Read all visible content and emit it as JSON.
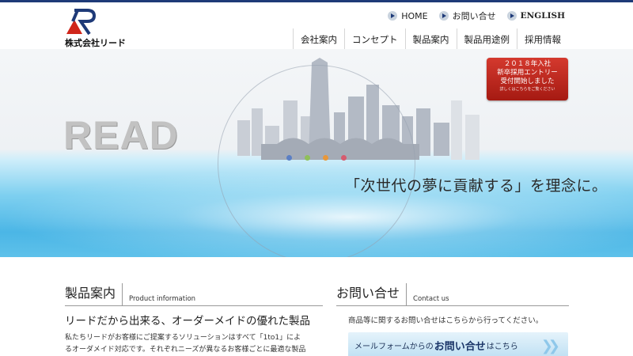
{
  "header": {
    "logo_text": "株式会社リード",
    "util_nav": [
      {
        "label": "HOME"
      },
      {
        "label": "お問い合せ"
      },
      {
        "label": "ENGLISH"
      }
    ],
    "main_nav": [
      {
        "label": "会社案内"
      },
      {
        "label": "コンセプト"
      },
      {
        "label": "製品案内"
      },
      {
        "label": "製品用途例"
      },
      {
        "label": "採用情報"
      }
    ]
  },
  "hero": {
    "brand_text": "READ",
    "tagline": "「次世代の夢に貢献する」を理念に。",
    "recruit": {
      "line1": "２０１８年入社",
      "line2": "新卒採用エントリー",
      "line3": "受付開始しました",
      "small": "詳しくはこちらをご覧ください"
    },
    "dot_colors": [
      "#5b7fc4",
      "#8fbf5a",
      "#e8973a",
      "#d65b6e"
    ]
  },
  "products": {
    "title": "製品案内",
    "subtitle": "Product information",
    "lead": "リードだから出来る、オーダーメイドの優れた製品",
    "body_line1": "私たちリードがお客様にご提案するソリューションはすべて「1to1」によ",
    "body_line2": "るオーダメイド対応です。それぞれニーズが異なるお客様ごとに最適な製品"
  },
  "contact": {
    "title": "お問い合せ",
    "subtitle": "Contact us",
    "body": "商品等に関するお問い合せはこちらから行ってください。",
    "button_pre": "メールフォームからの",
    "button_bold": "お問い合せ",
    "button_post": "はこちら"
  },
  "colors": {
    "brand_navy": "#1e3a78",
    "brand_red": "#d0261b",
    "badge_red": "#c22c22"
  }
}
